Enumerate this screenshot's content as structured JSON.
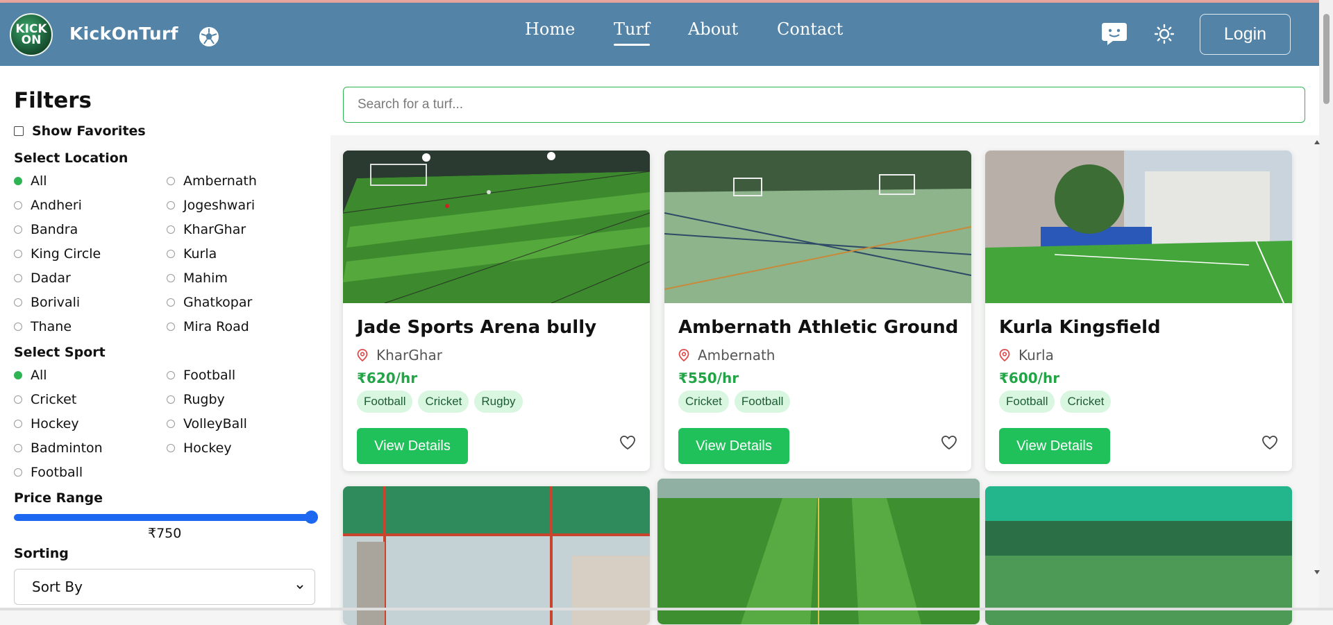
{
  "nav": {
    "logo_text_1": "KICK",
    "logo_text_2": "ON",
    "brand": "KickOnTurf",
    "links": [
      "Home",
      "Turf",
      "About",
      "Contact"
    ],
    "active_link": "Turf",
    "login_label": "Login",
    "icons": [
      "soccer-ball-icon",
      "chat-icon",
      "sun-icon"
    ]
  },
  "filters": {
    "title": "Filters",
    "show_favorites": "Show Favorites",
    "location_title": "Select Location",
    "locations": [
      "All",
      "Ambernath",
      "Andheri",
      "Jogeshwari",
      "Bandra",
      "KharGhar",
      "King Circle",
      "Kurla",
      "Dadar",
      "Mahim",
      "Borivali",
      "Ghatkopar",
      "Thane",
      "Mira Road"
    ],
    "location_selected": "All",
    "sport_title": "Select Sport",
    "sports": [
      "All",
      "Football",
      "Cricket",
      "Rugby",
      "Hockey",
      "VolleyBall",
      "Badminton",
      "Hockey",
      "Football"
    ],
    "sport_selected": "All",
    "price_title": "Price Range",
    "price_value": "₹750",
    "price_slider_fraction": 1.0,
    "sorting_title": "Sorting",
    "sort_value": "Sort By"
  },
  "search": {
    "placeholder": "Search for a turf..."
  },
  "cards": [
    {
      "title": "Jade Sports Arena bully",
      "location": "KharGhar",
      "price": "₹620/hr",
      "tags": [
        "Football",
        "Cricket",
        "Rugby"
      ],
      "button": "View Details"
    },
    {
      "title": "Ambernath Athletic Ground",
      "location": "Ambernath",
      "price": "₹550/hr",
      "tags": [
        "Cricket",
        "Football"
      ],
      "button": "View Details"
    },
    {
      "title": "Kurla Kingsfield",
      "location": "Kurla",
      "price": "₹600/hr",
      "tags": [
        "Football",
        "Cricket"
      ],
      "button": "View Details"
    }
  ],
  "colors": {
    "nav_bg": "#5383a6",
    "accent_green": "#20c15a",
    "price_green": "#22a447",
    "slider_blue": "#1d68f0"
  }
}
